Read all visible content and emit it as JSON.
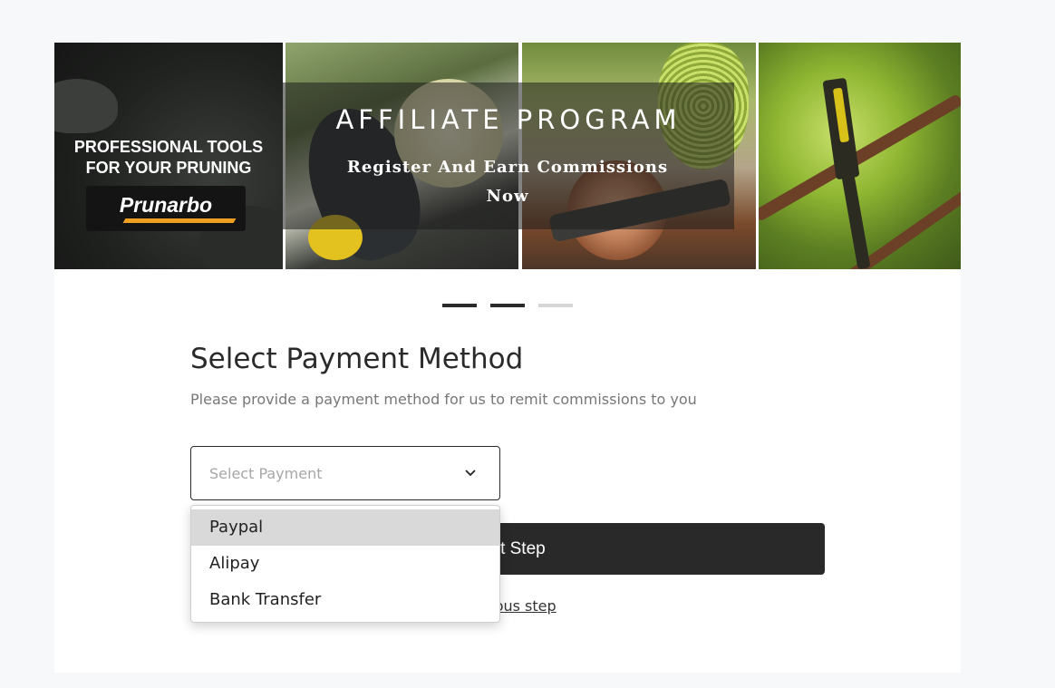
{
  "banner": {
    "left_line1": "PROFESSIONAL TOOLS",
    "left_line2": "FOR YOUR PRUNING",
    "logo": "Prunarbo",
    "title": "AFFILIATE PROGRAM",
    "subtitle": "Register And Earn Commissions Now"
  },
  "carousel": {
    "slide_count": 3,
    "active_slides": [
      0,
      1
    ]
  },
  "payment": {
    "title": "Select Payment Method",
    "description": "Please provide a payment method for us to remit commissions to you",
    "select_placeholder": "Select Payment",
    "options": [
      "Paypal",
      "Alipay",
      "Bank Transfer"
    ],
    "highlighted_option": "Paypal",
    "next_label": "Next Step",
    "previous_label": "Previous step"
  },
  "colors": {
    "button": "#292929",
    "highlight": "#d9d9d9",
    "page_bg": "#f7f8fa"
  }
}
